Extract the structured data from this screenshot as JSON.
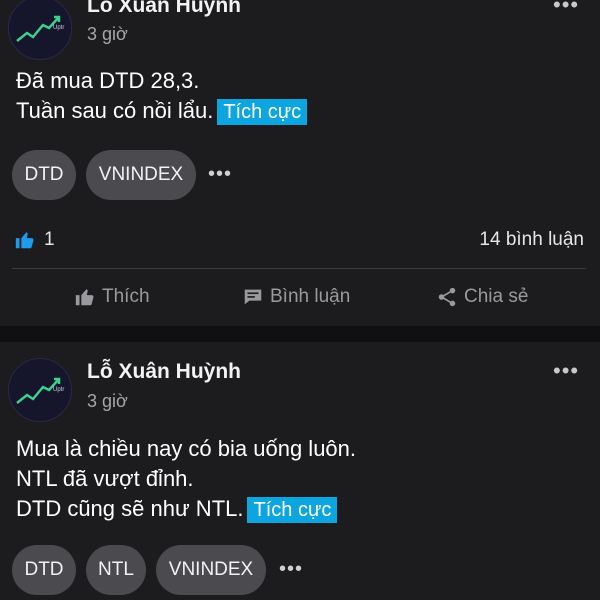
{
  "posts": [
    {
      "author": "Lỗ Xuân Huỳnh",
      "time": "3 giờ",
      "content_lines": [
        "Đã mua DTD 28,3.",
        "Tuần sau có nồi lẩu."
      ],
      "sentiment": "Tích cực",
      "tags": [
        "DTD",
        "VNINDEX"
      ],
      "likes": "1",
      "comments": "14 bình luận"
    },
    {
      "author": "Lỗ Xuân Huỳnh",
      "time": "3 giờ",
      "content_lines": [
        "Mua là chiều nay có bia uống luôn.",
        "NTL đã vượt đỉnh.",
        "DTD cũng sẽ như NTL."
      ],
      "sentiment": "Tích cực",
      "tags": [
        "DTD",
        "NTL",
        "VNINDEX"
      ]
    }
  ],
  "actions": {
    "like": "Thích",
    "comment": "Bình luận",
    "share": "Chia sẻ"
  },
  "more_glyph": "•••",
  "colors": {
    "background": "#1c1c1e",
    "sentiment": "#0ca5e0",
    "tag": "#4b4b4f",
    "like_blue": "#1e9bea"
  }
}
